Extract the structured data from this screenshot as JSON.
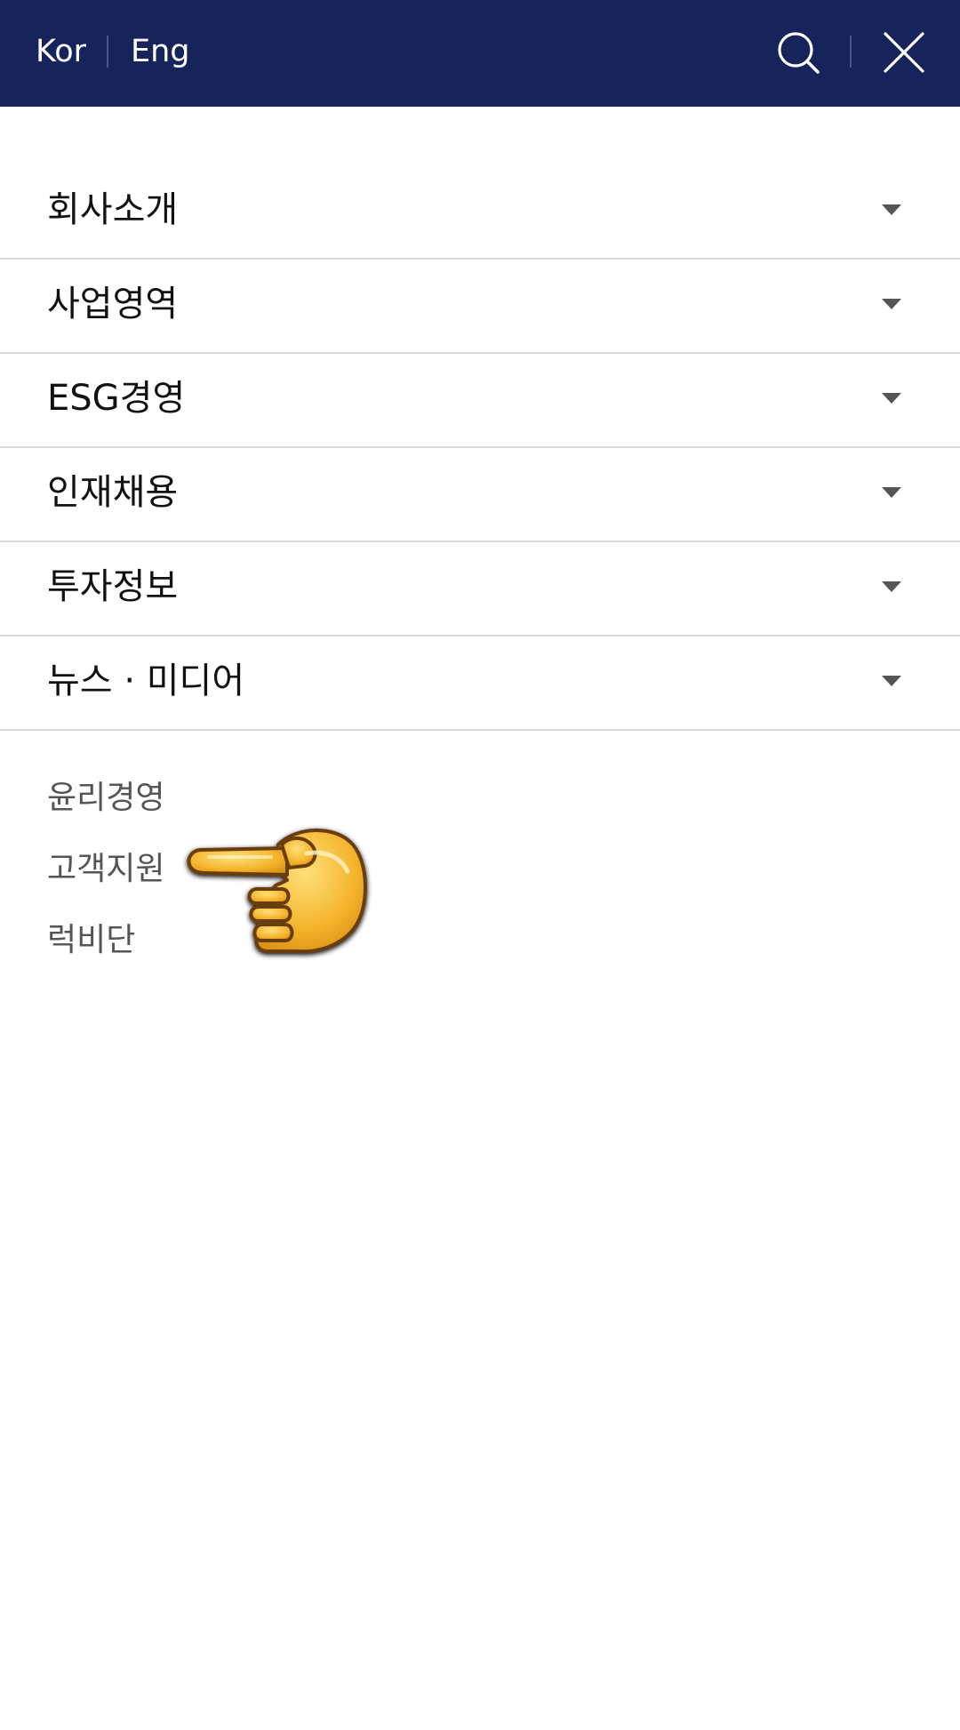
{
  "header": {
    "lang_kor": "Kor",
    "lang_eng": "Eng",
    "background_color": "#17245c",
    "icons": [
      "search-icon",
      "close-icon"
    ]
  },
  "menu": {
    "items": [
      {
        "label": "회사소개"
      },
      {
        "label": "사업영역"
      },
      {
        "label": "ESG경영"
      },
      {
        "label": "인재채용"
      },
      {
        "label": "투자정보"
      },
      {
        "label": "뉴스 · 미디어"
      }
    ],
    "caret_icon": "caret-down-icon"
  },
  "sub_links": [
    {
      "label": "윤리경영"
    },
    {
      "label": "고객지원"
    },
    {
      "label": "럭비단"
    }
  ],
  "overlay": {
    "icon": "pointing-hand-icon"
  }
}
